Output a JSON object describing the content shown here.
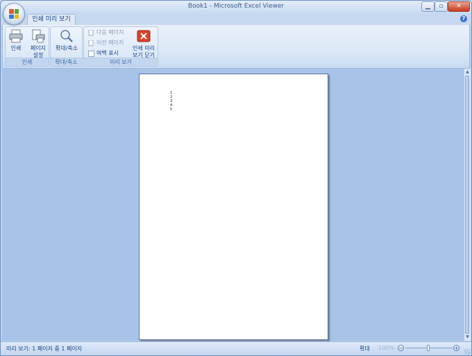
{
  "window": {
    "title": "Book1 - Microsoft Excel Viewer"
  },
  "ribbon": {
    "tab": "인쇄 미리 보기",
    "groups": {
      "print": {
        "label": "인쇄",
        "print_btn": "인쇄",
        "setup_btn_l1": "페이지",
        "setup_btn_l2": "설정"
      },
      "zoom": {
        "label": "확대/축소",
        "zoom_btn": "확대/축소"
      },
      "preview": {
        "label": "미리 보기",
        "next_page": "다음 페이지",
        "prev_page": "이전 페이지",
        "show_margins": "여백 표시",
        "close_l1": "인쇄 미리",
        "close_l2": "보기 닫기"
      }
    }
  },
  "page": {
    "rows": [
      "1",
      "2",
      "3",
      "4",
      "5"
    ]
  },
  "statusbar": {
    "text": "미리 보기: 1 페이지 중 1 페이지",
    "zoom_label": "확대",
    "zoom_pct": "100%"
  },
  "colors": {
    "accent": "#15428b",
    "close": "#c6391e",
    "workspace": "#a7c3e8"
  }
}
